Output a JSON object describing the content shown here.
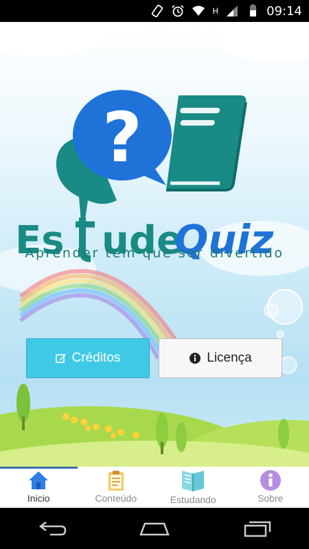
{
  "status_bar": {
    "time": "09:14",
    "network_letter": "H"
  },
  "app": {
    "logo_text_part1": "Es",
    "logo_text_part2": "ude",
    "logo_text_part3": "Quiz",
    "tagline": "Aprender tem que ser divertido",
    "colors": {
      "teal": "#1a8a85",
      "blue": "#1f73d8",
      "button_cyan": "#3fc9e6"
    }
  },
  "buttons": {
    "creditos": {
      "label": "Créditos",
      "icon": "edit-icon"
    },
    "licenca": {
      "label": "Licença",
      "icon": "info-circle-icon"
    }
  },
  "tabs": [
    {
      "label": "Inicio",
      "icon": "home-icon",
      "active": true
    },
    {
      "label": "Conteúdo",
      "icon": "clipboard-icon",
      "active": false
    },
    {
      "label": "Estudando",
      "icon": "book-icon",
      "active": false
    },
    {
      "label": "Sobre",
      "icon": "info-icon",
      "active": false
    }
  ],
  "nav": {
    "back": "back-icon",
    "home": "home-nav-icon",
    "recents": "recents-icon"
  }
}
